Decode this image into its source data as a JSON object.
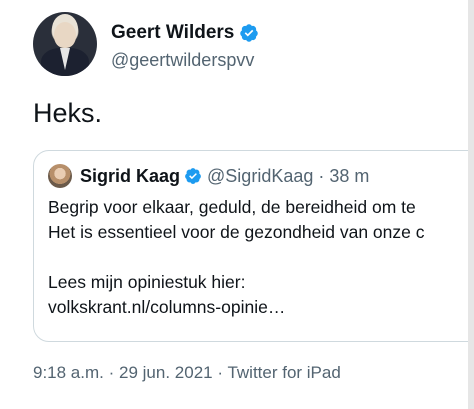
{
  "author": {
    "name": "Geert Wilders",
    "handle": "@geertwilderspvv"
  },
  "tweet": {
    "text": "Heks."
  },
  "quoted_tweet": {
    "name": "Sigrid Kaag",
    "handle": "@SigridKaag",
    "separator": "·",
    "time": "38 m",
    "lines": [
      "Begrip voor elkaar, geduld, de bereidheid om te",
      "Het is essentieel voor de gezondheid van onze c",
      "Lees mijn opiniestuk hier:",
      "volkskrant.nl/columns-opinie…"
    ]
  },
  "meta": {
    "time": "9:18 a.m.",
    "sep1": "·",
    "date": "29 jun. 2021",
    "sep2": "·",
    "source": "Twitter for iPad"
  },
  "colors": {
    "verified": "#1d9bf0",
    "secondary_text": "#536471",
    "border": "#cfd9de"
  },
  "icons": {
    "verified": "verified-badge-icon"
  }
}
